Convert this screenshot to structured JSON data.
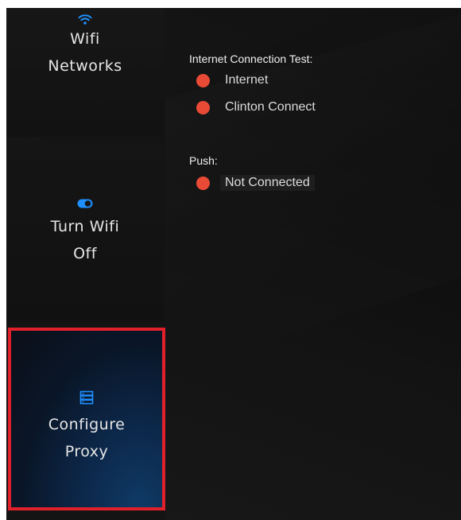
{
  "sidebar": {
    "tiles": [
      {
        "label": "Wifi\nNetworks",
        "icon": "wifi-icon"
      },
      {
        "label": "Turn Wifi\nOff",
        "icon": "toggle-icon"
      },
      {
        "label": "Configure\nProxy",
        "icon": "server-icon"
      }
    ],
    "selected_tile": "Configure Proxy"
  },
  "connection_test": {
    "title": "Internet Connection Test:",
    "items": [
      {
        "label": "Internet",
        "status_color": "#e84a35"
      },
      {
        "label": "Clinton Connect",
        "status_color": "#e84a35"
      }
    ]
  },
  "push": {
    "title": "Push:",
    "items": [
      {
        "label": "Not Connected",
        "status_color": "#e84a35"
      }
    ]
  },
  "colors": {
    "accent": "#1e90ff",
    "selection_border": "#e0202a",
    "status_error": "#e84a35",
    "background": "#141414"
  }
}
